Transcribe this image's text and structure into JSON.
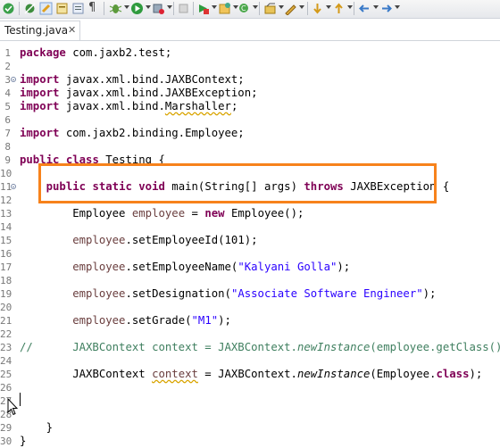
{
  "toolbar": {
    "icons": [
      "save-icon",
      "skip-breakpoints-icon",
      "toggle-mark-icon",
      "open-task-icon",
      "show-whitespace-icon",
      "pilcrow-icon",
      "debug-icon",
      "run-icon",
      "stop-icon",
      "terminate-icon",
      "run-external-icon",
      "new-project-icon",
      "search-icon",
      "next-annotation-icon",
      "back-icon",
      "forward-icon"
    ],
    "pilcrow": "¶"
  },
  "tab": {
    "label": "Testing.java",
    "close": "✕"
  },
  "editor": {
    "line_numbers": [
      "1",
      "2",
      "3",
      "4",
      "5",
      "6",
      "7",
      "8",
      "9",
      "10",
      "11",
      "12",
      "13",
      "14",
      "15",
      "16",
      "17",
      "18",
      "19",
      "20",
      "21",
      "22",
      "23",
      "24",
      "25",
      "26",
      "27",
      "28",
      "29",
      "30"
    ],
    "lines": {
      "l1_kw": "package",
      "l1_rest": " com.jaxb2.test;",
      "l3_kw": "import",
      "l3_rest": " javax.xml.bind.JAXBContext;",
      "l4_kw": "import",
      "l4_rest": " javax.xml.bind.JAXBException;",
      "l5_kw": "import",
      "l5_a": " javax.xml.bind.",
      "l5_b": "Marshaller",
      "l5_c": ";",
      "l7_kw": "import",
      "l7_rest": " com.jaxb2.binding.Employee;",
      "l9_kw1": "public",
      "l9_kw2": "class",
      "l9_rest": " Testing {",
      "l11_indent": "    ",
      "l11_kw1": "public",
      "l11_kw2": "static",
      "l11_kw3": "void",
      "l11_mid": " main(String[] args) ",
      "l11_kw4": "throws",
      "l11_rest": " JAXBException {",
      "l13_indent": "        ",
      "l13_a": "Employee ",
      "l13_var": "employee",
      "l13_b": " = ",
      "l13_kw": "new",
      "l13_c": " Employee();",
      "l15_indent": "        ",
      "l15_var": "employee",
      "l15_rest": ".setEmployeeId(101);",
      "l17_indent": "        ",
      "l17_var": "employee",
      "l17_a": ".setEmployeeName(",
      "l17_str": "\"Kalyani Golla\"",
      "l17_b": ");",
      "l19_indent": "        ",
      "l19_var": "employee",
      "l19_a": ".setDesignation(",
      "l19_str": "\"Associate Software Engineer\"",
      "l19_b": ");",
      "l21_indent": "        ",
      "l21_var": "employee",
      "l21_a": ".setGrade(",
      "l21_str": "\"M1\"",
      "l21_b": ");",
      "l23_comment": "//      JAXBContext context = JAXBContext.",
      "l23_it": "newInstance",
      "l23_rest": "(employee.getClass());",
      "l25_indent": "        ",
      "l25_a": "JAXBContext ",
      "l25_var": "context",
      "l25_b": " = JAXBContext.",
      "l25_it": "newInstance",
      "l25_c": "(Employee.",
      "l25_kw": "class",
      "l25_d": ");",
      "l29_text": "    }",
      "l30_text": "}"
    }
  },
  "colors": {
    "keyword": "#7f0055",
    "string": "#2a00ff",
    "comment": "#3f7f5f",
    "highlight": "#f7821b"
  }
}
